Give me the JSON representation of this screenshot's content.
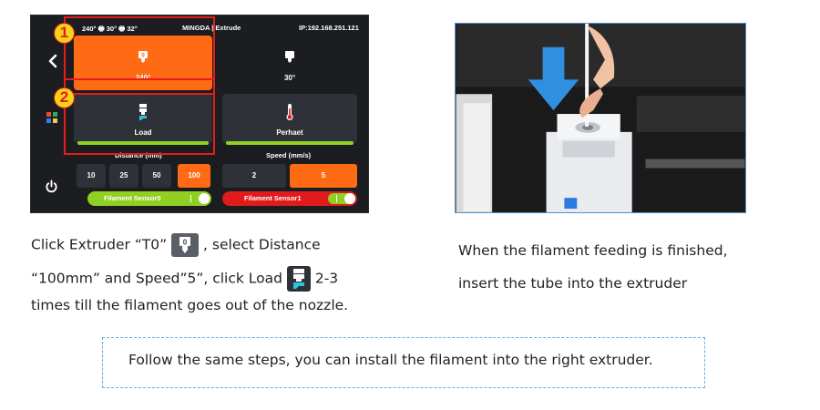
{
  "screen": {
    "status_temps": "240° 🖶 30° 🖶 32°",
    "status_title": "MINGDA | Extrude",
    "status_ip": "IP:192.168.251.121",
    "t0_temp": "240°",
    "t0_icon_text": "0",
    "t1_temp": "30°",
    "load_label": "Load",
    "preheat_label": "Perhaet",
    "distance_header": "Distance (mm)",
    "speed_header": "Speed (mm/s)",
    "distance_options": [
      "10",
      "25",
      "50",
      "100"
    ],
    "distance_selected": "100",
    "speed_options": [
      "2",
      "5"
    ],
    "speed_selected": "5",
    "sensor0_label": "Filament Sensor0",
    "sensor1_label": "Filament Sensor1",
    "accent_color": "#ff6a14",
    "ok_color": "#8fd022",
    "alert_color": "#e11b1b"
  },
  "markers": [
    "1",
    "2"
  ],
  "instructions": {
    "left_line1_a": "Click Extruder “T0”",
    "left_line1_b": ",  select Distance",
    "left_line2_a": "“100mm” and Speed”5”, click Load",
    "left_line2_b": "2-3",
    "left_line3": "times till the filament goes out of the nozzle.",
    "right_line1": "When the filament feeding is finished,",
    "right_line2": "insert the tube into the extruder"
  },
  "note": "Follow the same steps, you can install the filament into the right extruder.",
  "icons": [
    "back-arrow-icon",
    "apps-grid-icon",
    "power-icon",
    "extruder-icon",
    "load-icon",
    "thermometer-icon",
    "down-arrow-icon"
  ]
}
